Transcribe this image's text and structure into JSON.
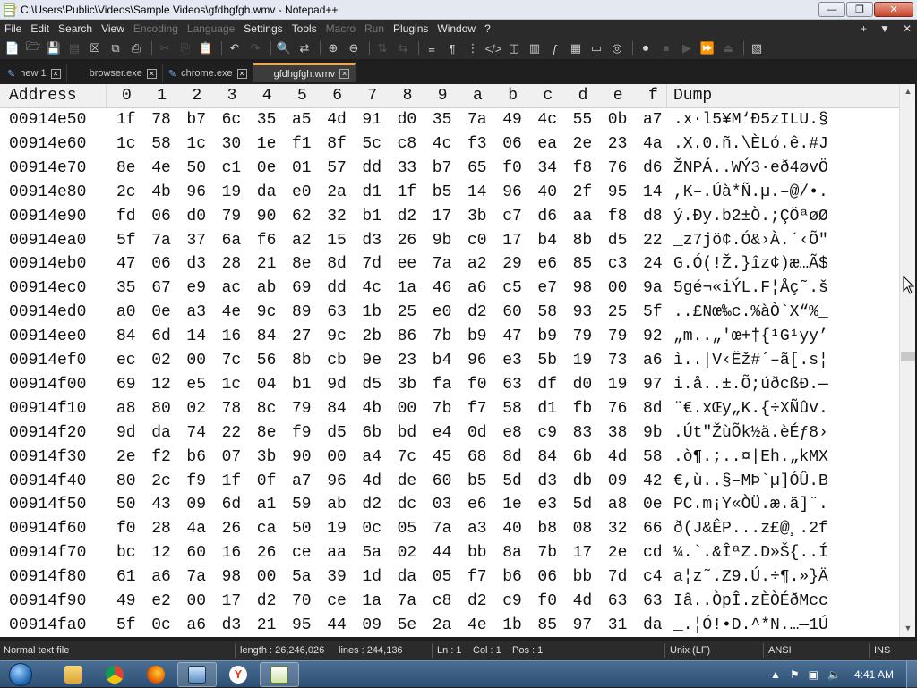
{
  "window": {
    "title": "C:\\Users\\Public\\Videos\\Sample Videos\\gfdhgfgh.wmv - Notepad++",
    "buttons": {
      "minimize": "—",
      "maximize": "❐",
      "close": "✕"
    }
  },
  "menu": {
    "items": [
      {
        "label": "File",
        "enabled": true
      },
      {
        "label": "Edit",
        "enabled": true
      },
      {
        "label": "Search",
        "enabled": true
      },
      {
        "label": "View",
        "enabled": true
      },
      {
        "label": "Encoding",
        "enabled": false
      },
      {
        "label": "Language",
        "enabled": false
      },
      {
        "label": "Settings",
        "enabled": true
      },
      {
        "label": "Tools",
        "enabled": true
      },
      {
        "label": "Macro",
        "enabled": false
      },
      {
        "label": "Run",
        "enabled": false
      },
      {
        "label": "Plugins",
        "enabled": true
      },
      {
        "label": "Window",
        "enabled": true
      },
      {
        "label": "?",
        "enabled": true
      }
    ],
    "right": {
      "plus": "+",
      "dropdown": "▼",
      "close": "✕"
    }
  },
  "toolbar": {
    "icons": [
      "new-file-icon",
      "open-file-icon",
      "save-icon",
      "save-all-icon",
      "close-icon",
      "close-all-icon",
      "print-icon",
      "cut-icon",
      "copy-icon",
      "paste-icon",
      "undo-icon",
      "redo-icon",
      "find-icon",
      "replace-icon",
      "zoom-in-icon",
      "zoom-out-icon",
      "sync-v-icon",
      "sync-h-icon",
      "word-wrap-icon",
      "show-all-chars-icon",
      "indent-guide-icon",
      "xml-tags-icon",
      "user-lang-icon",
      "doc-map-icon",
      "function-list-icon",
      "folder-workspace-icon",
      "monitor-icon",
      "record-macro-icon",
      "stop-macro-icon",
      "play-macro-icon",
      "run-macro-multiple-icon",
      "save-macro-icon",
      "hex-editor-icon"
    ]
  },
  "tabs": [
    {
      "label": "new 1",
      "active": false,
      "modified_icon": true
    },
    {
      "label": "browser.exe",
      "active": false,
      "modified_icon": false
    },
    {
      "label": "chrome.exe",
      "active": false,
      "modified_icon": true
    },
    {
      "label": "gfdhgfgh.wmv",
      "active": true,
      "modified_icon": false
    }
  ],
  "hex": {
    "header": {
      "address": "Address",
      "columns": [
        "0",
        "1",
        "2",
        "3",
        "4",
        "5",
        "6",
        "7",
        "8",
        "9",
        "a",
        "b",
        "c",
        "d",
        "e",
        "f"
      ],
      "dump": "Dump"
    },
    "rows": [
      {
        "addr": "00914e50",
        "bytes": [
          "1f",
          "78",
          "b7",
          "6c",
          "35",
          "a5",
          "4d",
          "91",
          "d0",
          "35",
          "7a",
          "49",
          "4c",
          "55",
          "0b",
          "a7"
        ],
        "dump": ".x·l5¥M‘Ð5zILU.§"
      },
      {
        "addr": "00914e60",
        "bytes": [
          "1c",
          "58",
          "1c",
          "30",
          "1e",
          "f1",
          "8f",
          "5c",
          "c8",
          "4c",
          "f3",
          "06",
          "ea",
          "2e",
          "23",
          "4a"
        ],
        "dump": ".X.0.ñ.\\ÈLó.ê.#J"
      },
      {
        "addr": "00914e70",
        "bytes": [
          "8e",
          "4e",
          "50",
          "c1",
          "0e",
          "01",
          "57",
          "dd",
          "33",
          "b7",
          "65",
          "f0",
          "34",
          "f8",
          "76",
          "d6"
        ],
        "dump": "ŽNPÁ..WÝ3·eð4øvÖ"
      },
      {
        "addr": "00914e80",
        "bytes": [
          "2c",
          "4b",
          "96",
          "19",
          "da",
          "e0",
          "2a",
          "d1",
          "1f",
          "b5",
          "14",
          "96",
          "40",
          "2f",
          "95",
          "14"
        ],
        "dump": ",K–.Úà*Ñ.µ.–@/•."
      },
      {
        "addr": "00914e90",
        "bytes": [
          "fd",
          "06",
          "d0",
          "79",
          "90",
          "62",
          "32",
          "b1",
          "d2",
          "17",
          "3b",
          "c7",
          "d6",
          "aa",
          "f8",
          "d8"
        ],
        "dump": "ý.Ðy.b2±Ò.;ÇÖªøØ"
      },
      {
        "addr": "00914ea0",
        "bytes": [
          "5f",
          "7a",
          "37",
          "6a",
          "f6",
          "a2",
          "15",
          "d3",
          "26",
          "9b",
          "c0",
          "17",
          "b4",
          "8b",
          "d5",
          "22"
        ],
        "dump": "_z7jö¢.Ó&›À.´‹Õ\""
      },
      {
        "addr": "00914eb0",
        "bytes": [
          "47",
          "06",
          "d3",
          "28",
          "21",
          "8e",
          "8d",
          "7d",
          "ee",
          "7a",
          "a2",
          "29",
          "e6",
          "85",
          "c3",
          "24"
        ],
        "dump": "G.Ó(!Ž.}îz¢)æ…Ã$"
      },
      {
        "addr": "00914ec0",
        "bytes": [
          "35",
          "67",
          "e9",
          "ac",
          "ab",
          "69",
          "dd",
          "4c",
          "1a",
          "46",
          "a6",
          "c5",
          "e7",
          "98",
          "00",
          "9a"
        ],
        "dump": "5gé¬«iÝL.F¦Åç˜.š"
      },
      {
        "addr": "00914ed0",
        "bytes": [
          "a0",
          "0e",
          "a3",
          "4e",
          "9c",
          "89",
          "63",
          "1b",
          "25",
          "e0",
          "d2",
          "60",
          "58",
          "93",
          "25",
          "5f"
        ],
        "dump": "..£Nœ‰c.%àÒ`X“%_"
      },
      {
        "addr": "00914ee0",
        "bytes": [
          "84",
          "6d",
          "14",
          "16",
          "84",
          "27",
          "9c",
          "2b",
          "86",
          "7b",
          "b9",
          "47",
          "b9",
          "79",
          "79",
          "92"
        ],
        "dump": "„m..„'œ+†{¹G¹yy’"
      },
      {
        "addr": "00914ef0",
        "bytes": [
          "ec",
          "02",
          "00",
          "7c",
          "56",
          "8b",
          "cb",
          "9e",
          "23",
          "b4",
          "96",
          "e3",
          "5b",
          "19",
          "73",
          "a6"
        ],
        "dump": "ì..|V‹Ëž#´–ã[.s¦"
      },
      {
        "addr": "00914f00",
        "bytes": [
          "69",
          "12",
          "e5",
          "1c",
          "04",
          "b1",
          "9d",
          "d5",
          "3b",
          "fa",
          "f0",
          "63",
          "df",
          "d0",
          "19",
          "97"
        ],
        "dump": "i.å..±.Õ;úðcßÐ.—"
      },
      {
        "addr": "00914f10",
        "bytes": [
          "a8",
          "80",
          "02",
          "78",
          "8c",
          "79",
          "84",
          "4b",
          "00",
          "7b",
          "f7",
          "58",
          "d1",
          "fb",
          "76",
          "8d"
        ],
        "dump": "¨€.xŒy„K.{÷XÑûv."
      },
      {
        "addr": "00914f20",
        "bytes": [
          "9d",
          "da",
          "74",
          "22",
          "8e",
          "f9",
          "d5",
          "6b",
          "bd",
          "e4",
          "0d",
          "e8",
          "c9",
          "83",
          "38",
          "9b"
        ],
        "dump": ".Út\"ŽùÕk½ä.èÉƒ8›"
      },
      {
        "addr": "00914f30",
        "bytes": [
          "2e",
          "f2",
          "b6",
          "07",
          "3b",
          "90",
          "00",
          "a4",
          "7c",
          "45",
          "68",
          "8d",
          "84",
          "6b",
          "4d",
          "58"
        ],
        "dump": ".ò¶.;..¤|Eh.„kMX"
      },
      {
        "addr": "00914f40",
        "bytes": [
          "80",
          "2c",
          "f9",
          "1f",
          "0f",
          "a7",
          "96",
          "4d",
          "de",
          "60",
          "b5",
          "5d",
          "d3",
          "db",
          "09",
          "42"
        ],
        "dump": "€,ù..§–MÞ`µ]ÓÛ.B"
      },
      {
        "addr": "00914f50",
        "bytes": [
          "50",
          "43",
          "09",
          "6d",
          "a1",
          "59",
          "ab",
          "d2",
          "dc",
          "03",
          "e6",
          "1e",
          "e3",
          "5d",
          "a8",
          "0e"
        ],
        "dump": "PC.m¡Y«ÒÜ.æ.ã]¨."
      },
      {
        "addr": "00914f60",
        "bytes": [
          "f0",
          "28",
          "4a",
          "26",
          "ca",
          "50",
          "19",
          "0c",
          "05",
          "7a",
          "a3",
          "40",
          "b8",
          "08",
          "32",
          "66"
        ],
        "dump": "ð(J&ÊP...z£@¸.2f"
      },
      {
        "addr": "00914f70",
        "bytes": [
          "bc",
          "12",
          "60",
          "16",
          "26",
          "ce",
          "aa",
          "5a",
          "02",
          "44",
          "bb",
          "8a",
          "7b",
          "17",
          "2e",
          "cd"
        ],
        "dump": "¼.`.&ÎªZ.D»Š{..Í"
      },
      {
        "addr": "00914f80",
        "bytes": [
          "61",
          "a6",
          "7a",
          "98",
          "00",
          "5a",
          "39",
          "1d",
          "da",
          "05",
          "f7",
          "b6",
          "06",
          "bb",
          "7d",
          "c4"
        ],
        "dump": "a¦z˜.Z9.Ú.÷¶.»}Ä"
      },
      {
        "addr": "00914f90",
        "bytes": [
          "49",
          "e2",
          "00",
          "17",
          "d2",
          "70",
          "ce",
          "1a",
          "7a",
          "c8",
          "d2",
          "c9",
          "f0",
          "4d",
          "63",
          "63"
        ],
        "dump": "Iâ..ÒpÎ.zÈÒÉðMcc"
      },
      {
        "addr": "00914fa0",
        "bytes": [
          "5f",
          "0c",
          "a6",
          "d3",
          "21",
          "95",
          "44",
          "09",
          "5e",
          "2a",
          "4e",
          "1b",
          "85",
          "97",
          "31",
          "da"
        ],
        "dump": "_.¦Ó!•D.^*N.…—1Ú"
      }
    ]
  },
  "status": {
    "type": "Normal text file",
    "length": "length : 26,246,026",
    "lines": "lines : 244,136",
    "ln": "Ln : 1",
    "col": "Col : 1",
    "pos": "Pos : 1",
    "eol": "Unix (LF)",
    "encoding": "ANSI",
    "mode": "INS"
  },
  "taskbar": {
    "apps": [
      "explorer-icon",
      "chrome-icon",
      "firefox-icon",
      "remote-desktop-icon",
      "yandex-icon",
      "notepad-plus-plus-icon"
    ],
    "clock": "4:41 AM",
    "tray_icons": [
      "show-hidden-icons-icon",
      "action-center-flag-icon",
      "network-icon",
      "volume-icon"
    ]
  },
  "colors": {
    "menubar_bg": "#2b2b2b",
    "editor_bg": "#ffffff",
    "active_tab_accent": "#f0a64a",
    "taskbar_bg": "#3a5f84"
  }
}
